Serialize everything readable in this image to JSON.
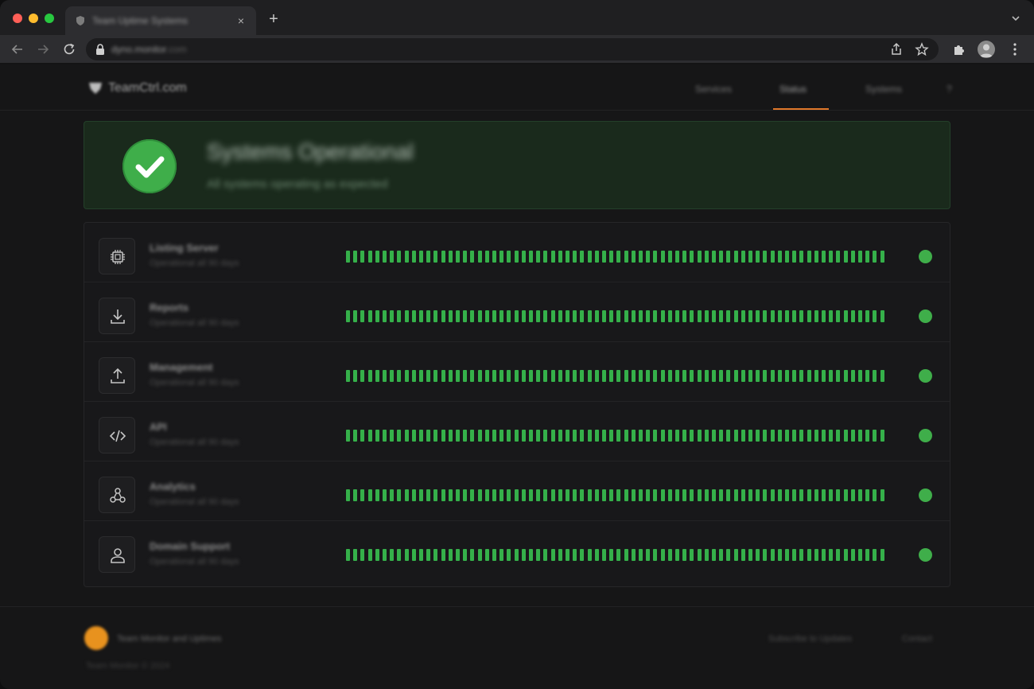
{
  "browser": {
    "tab_title": "Team Uptime Systems",
    "tab_close_glyph": "×",
    "new_tab_glyph": "+",
    "url_host": "dyno.monitor",
    "url_tail": ".com"
  },
  "site": {
    "logo_text": "TeamCtrl.com",
    "nav": [
      "Services",
      "Status",
      "Systems",
      "?"
    ],
    "active_nav": 1,
    "accent_color": "#e0782a"
  },
  "banner": {
    "title": "Systems Operational",
    "subtitle": "All systems operating as expected",
    "status_color": "#3fae4a"
  },
  "services": [
    {
      "name": "Listing Server",
      "desc": "Operational all 90 days",
      "icon": "chip-icon",
      "status": "operational",
      "uptime_days": 90
    },
    {
      "name": "Reports",
      "desc": "Operational all 90 days",
      "icon": "download-icon",
      "status": "operational",
      "uptime_days": 90
    },
    {
      "name": "Management",
      "desc": "Operational all 90 days",
      "icon": "upload-icon",
      "status": "operational",
      "uptime_days": 90
    },
    {
      "name": "API",
      "desc": "Operational all 90 days",
      "icon": "code-icon",
      "status": "operational",
      "uptime_days": 90
    },
    {
      "name": "Analytics",
      "desc": "Operational all 90 days",
      "icon": "network-icon",
      "status": "operational",
      "uptime_days": 90
    },
    {
      "name": "Domain Support",
      "desc": "Operational all 90 days",
      "icon": "user-icon",
      "status": "operational",
      "uptime_days": 90
    }
  ],
  "uptime_color": "#35b04a",
  "footer": {
    "text": "Team Monitor and Uptimes",
    "copyright": "Team Monitor © 2024",
    "links": [
      "Subscribe to Updates",
      "Contact"
    ]
  }
}
